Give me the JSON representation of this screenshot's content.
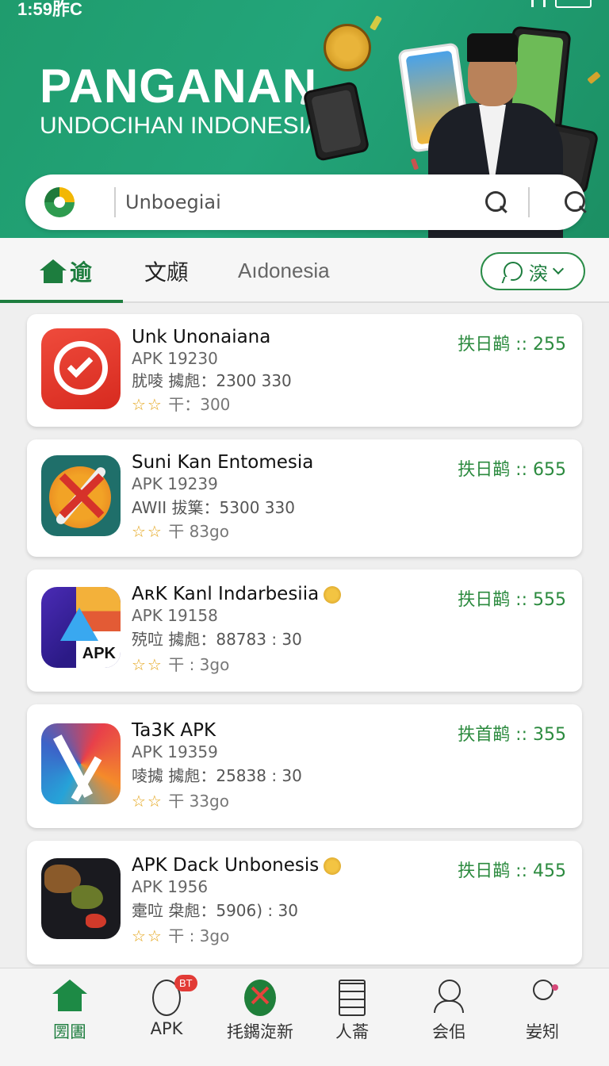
{
  "status": {
    "time": "1:59胙C"
  },
  "hero": {
    "title": "PANGANAN",
    "subtitle": "UNDOCIHAN INDONESIA"
  },
  "search": {
    "placeholder": "Unboegiai"
  },
  "tabs": {
    "home_label": "逾",
    "tab2_label": "文䫆",
    "tab3_label": "Aıdonesia",
    "filter_label": "㴱"
  },
  "apps": [
    {
      "name": "Unk Unonaiana",
      "version": "APK 19230",
      "meta": "肬㖫 㩀䖑：2300 330",
      "stars": "☆☆",
      "rating": "干：300",
      "size": "抶日鹋 :: 255",
      "coin": false
    },
    {
      "name": "Suni Kan Entomesia",
      "version": "APK 19239",
      "meta": "AWII 拔䈎：5300 330",
      "stars": "☆☆",
      "rating": "干 83go",
      "size": "抶日鹋 :: 655",
      "coin": false
    },
    {
      "name": "AʀK Kanl Indarbesiia",
      "version": "APK 19158",
      "meta": "殑㕸 㩀䖑：88783 : 30",
      "stars": "☆☆",
      "rating": "干 : 3go",
      "size": "抶日鹋 :: 555",
      "coin": true
    },
    {
      "name": "Ta3K APK",
      "version": "APK 19359",
      "meta": "㖫㩀 㩀䖑：25838 : 30",
      "stars": "☆☆",
      "rating": "干 33go",
      "size": "抶首鹋 :: 355",
      "coin": false
    },
    {
      "name": "APK Dack Unbonesis",
      "version": "APK  1956",
      "meta": "㚄㕸 㭧䖑：5906) : 30",
      "stars": "☆☆",
      "rating": "干 : 3go",
      "size": "抶日鹋 :: 455",
      "coin": true
    }
  ],
  "bottom_nav": [
    {
      "label": "圐圕",
      "icon": "home-icon"
    },
    {
      "label": "APK",
      "icon": "face-icon",
      "badge": "BT"
    },
    {
      "label": "㧌䥟㳬新",
      "icon": "close-circle-icon"
    },
    {
      "label": "人菕",
      "icon": "grid-icon"
    },
    {
      "label": "会佀",
      "icon": "user-icon"
    },
    {
      "label": "妛矧",
      "icon": "profile-icon"
    }
  ],
  "colors": {
    "brand_green": "#1d7d3e",
    "hero_bg": "#23a57a",
    "size_text": "#2b8a3e",
    "star": "#e4a418"
  }
}
